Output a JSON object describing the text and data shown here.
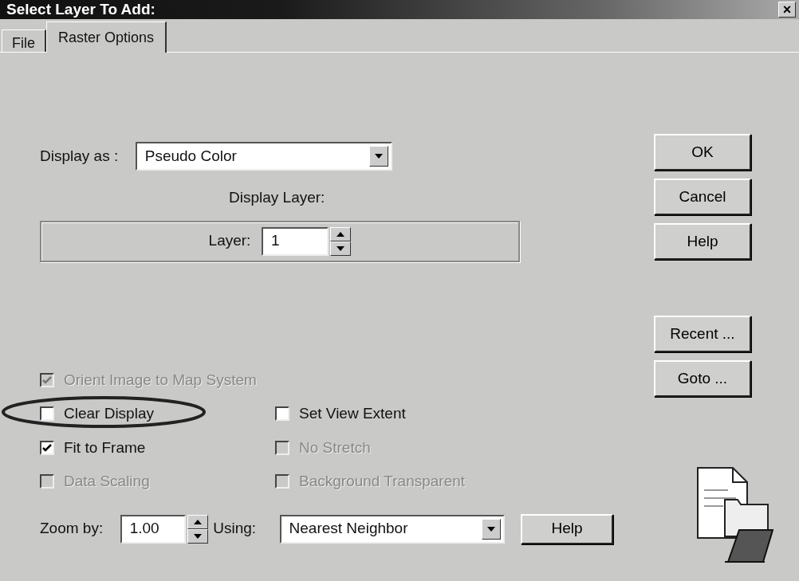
{
  "window": {
    "title": "Select Layer To Add:",
    "close": "×"
  },
  "tabs": [
    {
      "label": "File",
      "selected": false
    },
    {
      "label": "Raster Options",
      "selected": true
    }
  ],
  "display_as": {
    "label": "Display as :",
    "value": "Pseudo Color"
  },
  "display_layer": {
    "title": "Display Layer:",
    "label": "Layer:",
    "value": "1"
  },
  "buttons": [
    {
      "label": "OK"
    },
    {
      "label": "Cancel"
    },
    {
      "label": "Help"
    },
    {
      "label": "Recent ..."
    },
    {
      "label": "Goto ..."
    }
  ],
  "checkboxes": [
    {
      "label": "Orient Image to Map System",
      "checked": true,
      "disabled": true
    },
    {
      "label": "Clear Display",
      "checked": false,
      "disabled": false
    },
    {
      "label": "Set View Extent",
      "checked": false,
      "disabled": false
    },
    {
      "label": "Fit to Frame",
      "checked": true,
      "disabled": false
    },
    {
      "label": "No Stretch",
      "checked": false,
      "disabled": true
    },
    {
      "label": "Data Scaling",
      "checked": false,
      "disabled": true
    },
    {
      "label": "Background Transparent",
      "checked": false,
      "disabled": true
    }
  ],
  "zoom": {
    "label": "Zoom by:",
    "value": "1.00",
    "using_label": "Using:",
    "using_value": "Nearest Neighbor",
    "help": "Help"
  }
}
